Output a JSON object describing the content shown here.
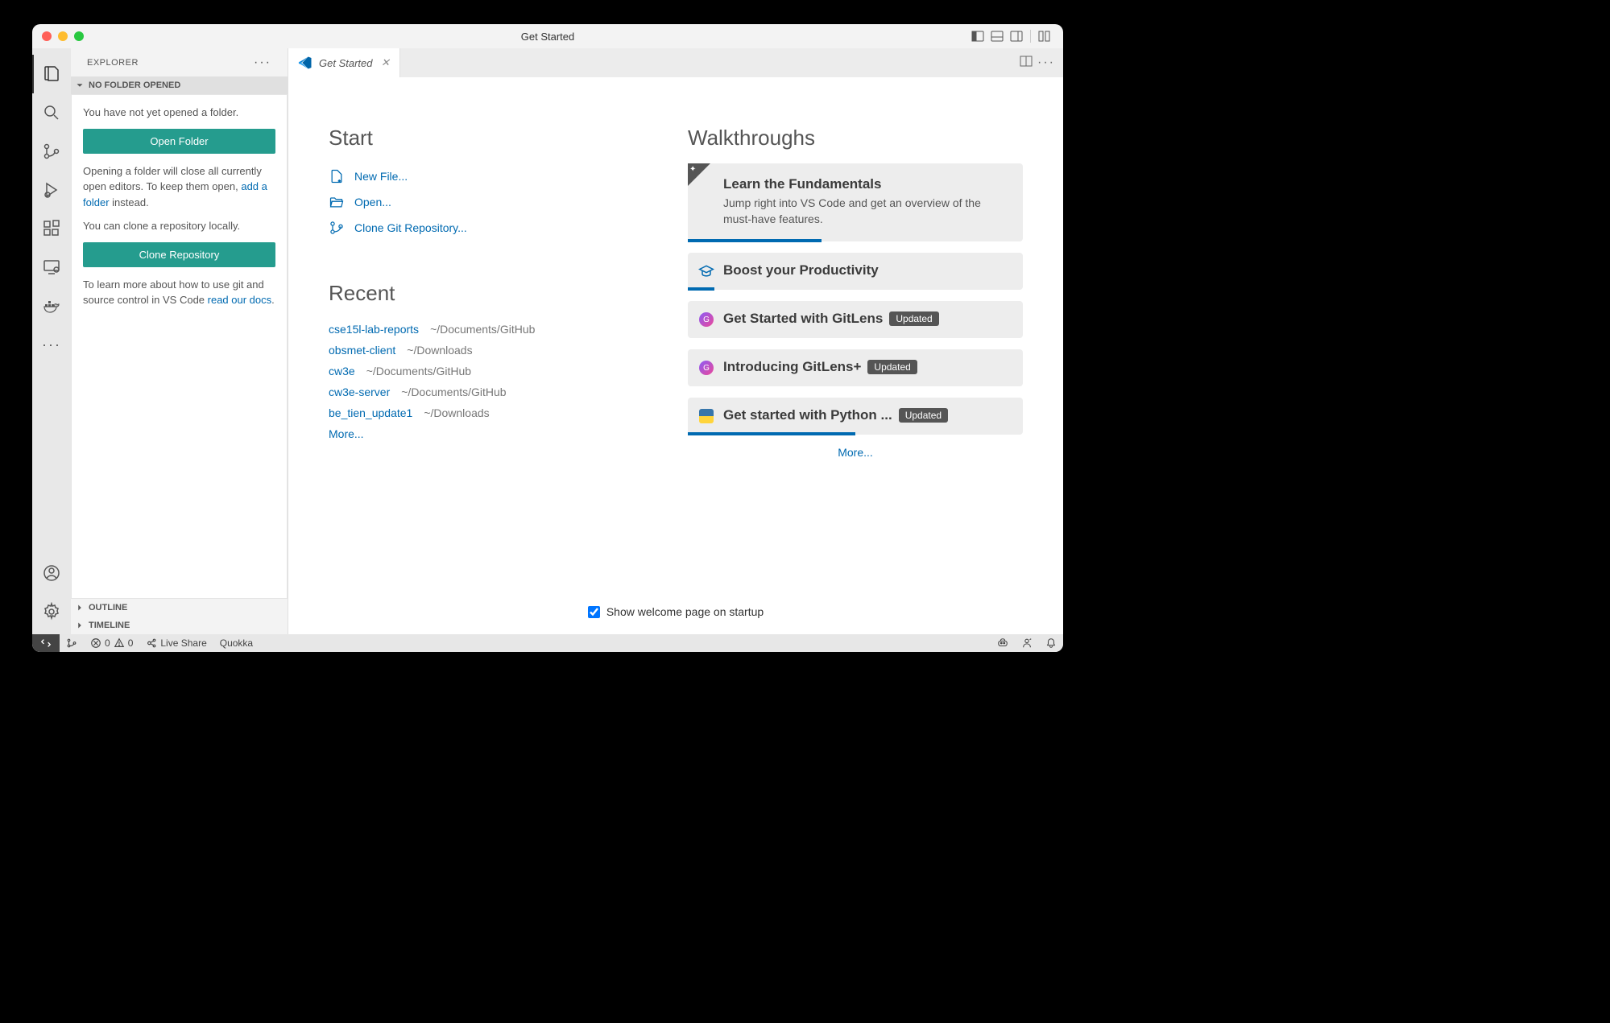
{
  "window": {
    "title": "Get Started"
  },
  "sidebar": {
    "title": "EXPLORER",
    "section_header": "NO FOLDER OPENED",
    "panel": {
      "line1": "You have not yet opened a folder.",
      "open_folder_btn": "Open Folder",
      "line2a": "Opening a folder will close all currently open editors. To keep them open, ",
      "line2_link": "add a folder",
      "line2b": " instead.",
      "line3": "You can clone a repository locally.",
      "clone_btn": "Clone Repository",
      "line4a": "To learn more about how to use git and source control in VS Code ",
      "line4_link": "read our docs",
      "line4b": "."
    },
    "outline": "OUTLINE",
    "timeline": "TIMELINE"
  },
  "tab": {
    "label": "Get Started"
  },
  "welcome": {
    "start_heading": "Start",
    "start_items": [
      {
        "label": "New File..."
      },
      {
        "label": "Open..."
      },
      {
        "label": "Clone Git Repository..."
      }
    ],
    "recent_heading": "Recent",
    "recent": [
      {
        "name": "cse15l-lab-reports",
        "path": "~/Documents/GitHub"
      },
      {
        "name": "obsmet-client",
        "path": "~/Downloads"
      },
      {
        "name": "cw3e",
        "path": "~/Documents/GitHub"
      },
      {
        "name": "cw3e-server",
        "path": "~/Documents/GitHub"
      },
      {
        "name": "be_tien_update1",
        "path": "~/Downloads"
      }
    ],
    "recent_more": "More...",
    "walkthroughs_heading": "Walkthroughs",
    "walkthroughs": [
      {
        "title": "Learn the Fundamentals",
        "desc": "Jump right into VS Code and get an overview of the must-have features.",
        "featured": true,
        "progress": 40
      },
      {
        "title": "Boost your Productivity",
        "progress": 8
      },
      {
        "title": "Get Started with GitLens",
        "badge": "Updated"
      },
      {
        "title": "Introducing GitLens+",
        "badge": "Updated"
      },
      {
        "title": "Get started with Python ...",
        "badge": "Updated",
        "progress": 50
      }
    ],
    "walk_more": "More...",
    "startup_label": "Show welcome page on startup"
  },
  "statusbar": {
    "errors": "0",
    "warnings": "0",
    "live_share": "Live Share",
    "quokka": "Quokka"
  }
}
